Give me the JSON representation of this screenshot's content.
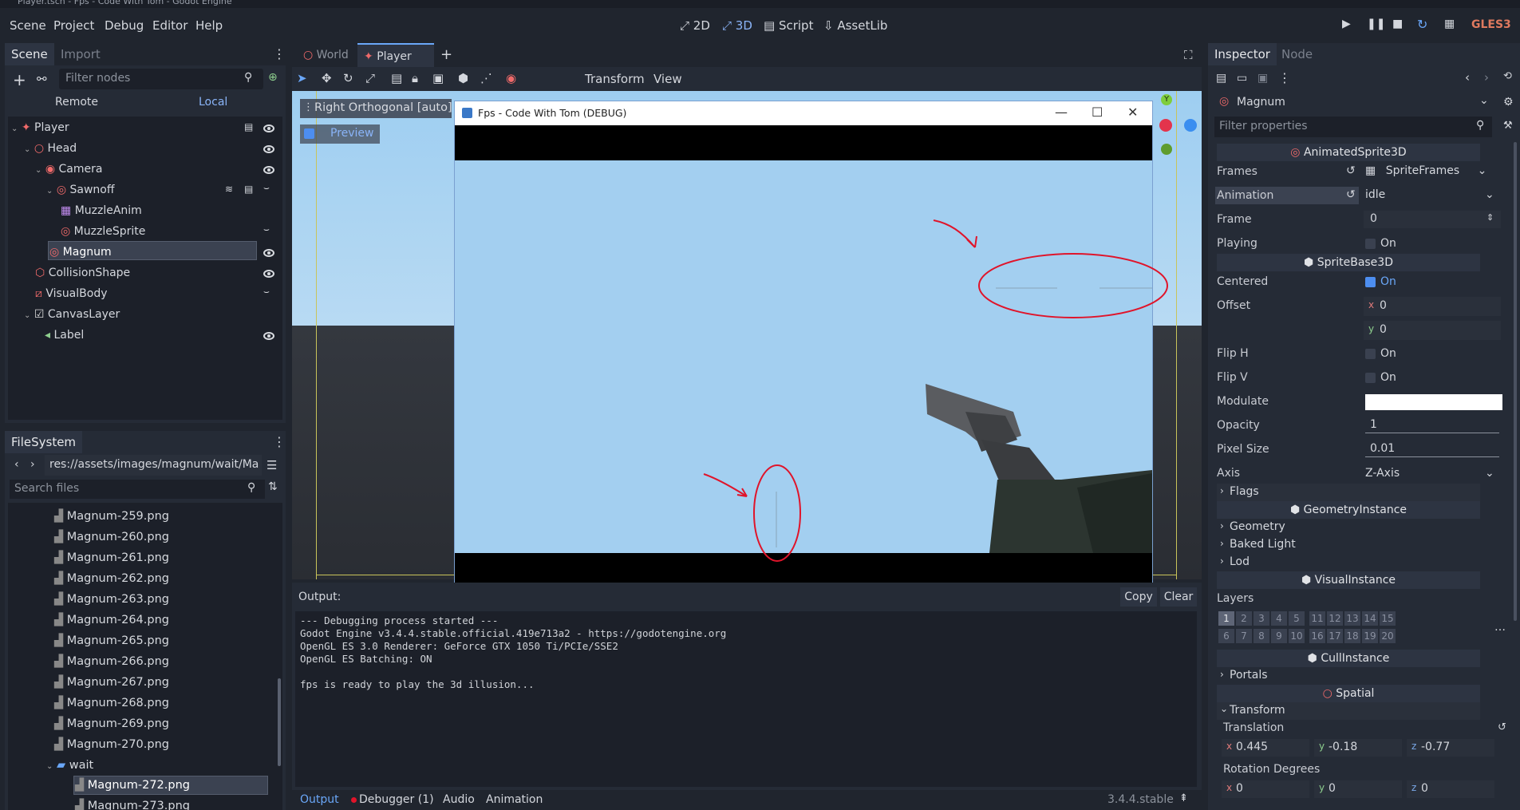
{
  "window_title": "Player.tscn - Fps - Code With Tom - Godot Engine",
  "menu": [
    "Scene",
    "Project",
    "Debug",
    "Editor",
    "Help"
  ],
  "workspaces": {
    "d2": "2D",
    "d3": "3D",
    "script": "Script",
    "assetlib": "AssetLib"
  },
  "renderer": "GLES3",
  "scene_dock": {
    "tabs": [
      "Scene",
      "Import"
    ],
    "filter_placeholder": "Filter nodes",
    "remote": "Remote",
    "local": "Local",
    "nodes": [
      "Player",
      "Head",
      "Camera",
      "Sawnoff",
      "MuzzleAnim",
      "MuzzleSprite",
      "Magnum",
      "CollisionShape",
      "VisualBody",
      "CanvasLayer",
      "Label"
    ]
  },
  "filesystem": {
    "title": "FileSystem",
    "path": "res://assets/images/magnum/wait/Ma",
    "search_placeholder": "Search files",
    "files": [
      "Magnum-259.png",
      "Magnum-260.png",
      "Magnum-261.png",
      "Magnum-262.png",
      "Magnum-263.png",
      "Magnum-264.png",
      "Magnum-265.png",
      "Magnum-266.png",
      "Magnum-267.png",
      "Magnum-268.png",
      "Magnum-269.png",
      "Magnum-270.png"
    ],
    "folder": "wait",
    "files_after": [
      "Magnum-272.png",
      "Magnum-273.png"
    ]
  },
  "editor_tabs": [
    "World",
    "Player"
  ],
  "viewport_toolbar": {
    "transform": "Transform",
    "view": "View"
  },
  "viewport": {
    "orthogonal_label": "Right Orthogonal [auto]",
    "preview": "Preview",
    "gizmo_y": "Y"
  },
  "game_window": {
    "title": "Fps - Code With Tom (DEBUG)"
  },
  "output": {
    "label": "Output:",
    "copy": "Copy",
    "clear": "Clear",
    "lines": [
      "--- Debugging process started ---",
      "Godot Engine v3.4.4.stable.official.419e713a2 - https://godotengine.org",
      "OpenGL ES 3.0 Renderer: GeForce GTX 1050 Ti/PCIe/SSE2",
      "OpenGL ES Batching: ON",
      "",
      "fps is ready to play the 3d illusion..."
    ]
  },
  "bottom_tabs": [
    "Output",
    "Debugger (1)",
    "Audio",
    "Animation"
  ],
  "version": "3.4.4.stable",
  "inspector": {
    "tabs": [
      "Inspector",
      "Node"
    ],
    "object": "Magnum",
    "filter_placeholder": "Filter properties",
    "sections": {
      "animated": "AnimatedSprite3D",
      "spritebase": "SpriteBase3D",
      "geometry": "GeometryInstance",
      "visual": "VisualInstance",
      "cull": "CullInstance",
      "spatial": "Spatial"
    },
    "labels": {
      "frames": "Frames",
      "animation": "Animation",
      "frame": "Frame",
      "playing": "Playing",
      "centered": "Centered",
      "offset": "Offset",
      "flip_h": "Flip H",
      "flip_v": "Flip V",
      "modulate": "Modulate",
      "opacity": "Opacity",
      "pixel_size": "Pixel Size",
      "axis": "Axis",
      "flags": "Flags",
      "geometry": "Geometry",
      "baked_light": "Baked Light",
      "lod": "Lod",
      "layers": "Layers",
      "portals": "Portals",
      "transform": "Transform",
      "translation": "Translation",
      "rotation": "Rotation Degrees",
      "on": "On"
    },
    "values": {
      "frames": "SpriteFrames",
      "animation": "idle",
      "frame": "0",
      "offset_x": "0",
      "offset_y": "0",
      "opacity": "1",
      "pixel_size": "0.01",
      "axis": "Z-Axis",
      "tx": "0.445",
      "ty": "-0.18",
      "tz": "-0.77",
      "rx": "0",
      "ry": "0",
      "rz": "0"
    },
    "layer_row1": [
      "1",
      "2",
      "3",
      "4",
      "5",
      "11",
      "12",
      "13",
      "14",
      "15"
    ],
    "layer_row2": [
      "6",
      "7",
      "8",
      "9",
      "10",
      "16",
      "17",
      "18",
      "19",
      "20"
    ],
    "axis_letters": {
      "x": "x",
      "y": "y",
      "z": "z"
    }
  },
  "colors": {
    "accent": "#4d8ef0",
    "red_marker": "#e0142a",
    "sky": "#a3cff0"
  }
}
